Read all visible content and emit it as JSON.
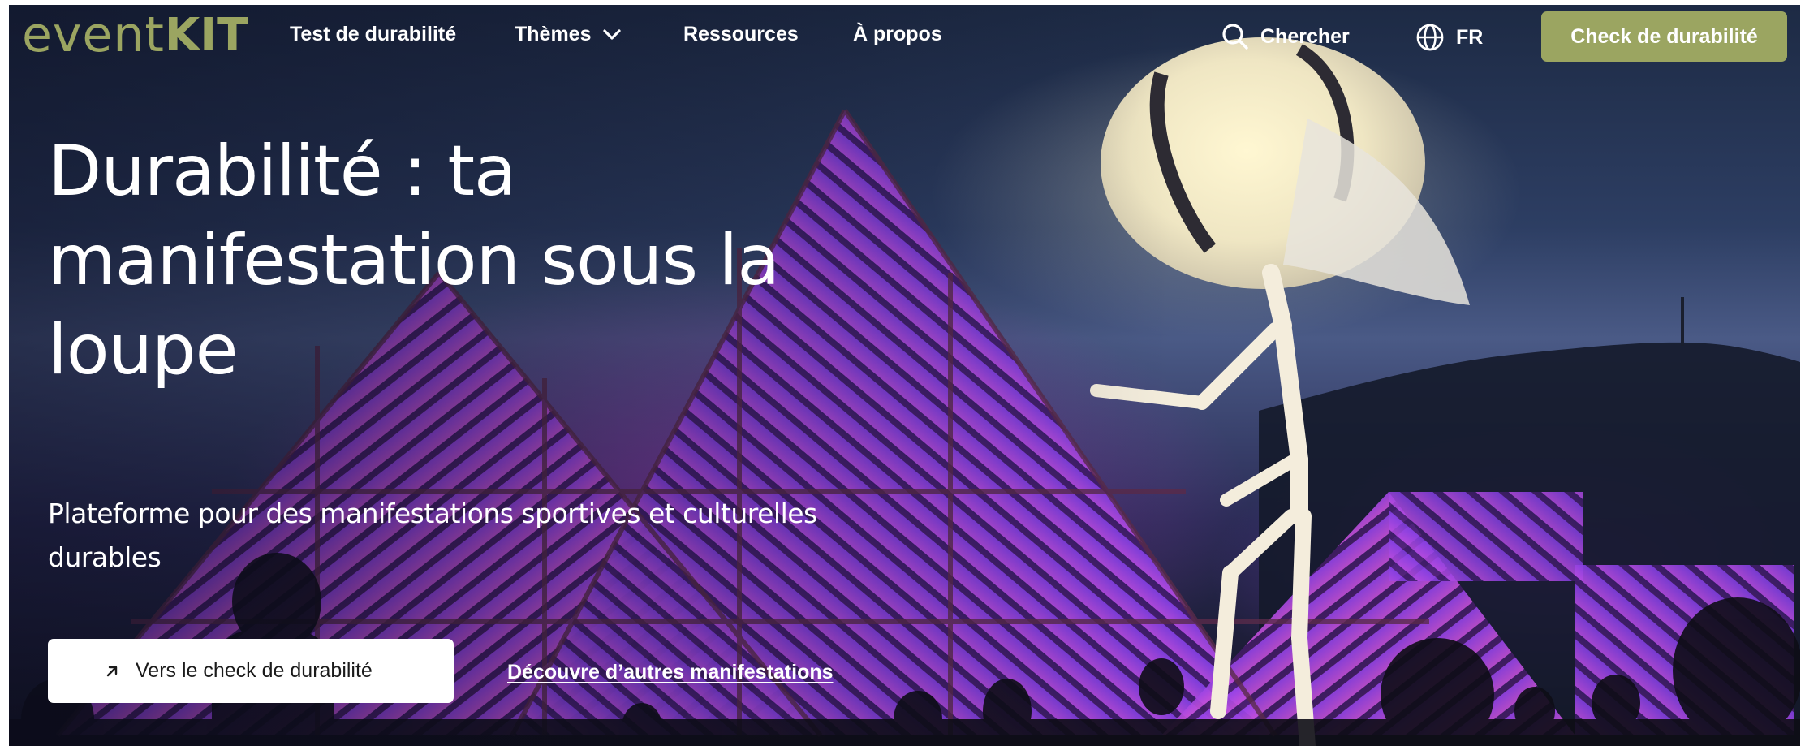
{
  "header": {
    "logo": {
      "part1": "event",
      "part2": "KIT"
    },
    "nav": {
      "test_label": "Test de durabilité",
      "themes_label": "Thèmes",
      "ressources_label": "Ressources",
      "apropos_label": "À propos"
    },
    "search_label": "Chercher",
    "language_label": "FR",
    "cta_label": "Check de durabilité"
  },
  "hero": {
    "title": "Durabilité : ta manifestation sous la loupe",
    "subtitle": "Plateforme pour des manifestations sportives et culturelles durables",
    "primary_button_label": "Vers le check de durabilité",
    "secondary_link_label": "Découvre d’autres manifestations"
  },
  "colors": {
    "brand": "#9ba561",
    "text_light": "#ffffff",
    "button_text": "#1b1b1b"
  },
  "icons": {
    "search": "search-icon",
    "globe": "globe-icon",
    "chevron": "chevron-down-icon",
    "arrow": "arrow-up-right-icon"
  }
}
